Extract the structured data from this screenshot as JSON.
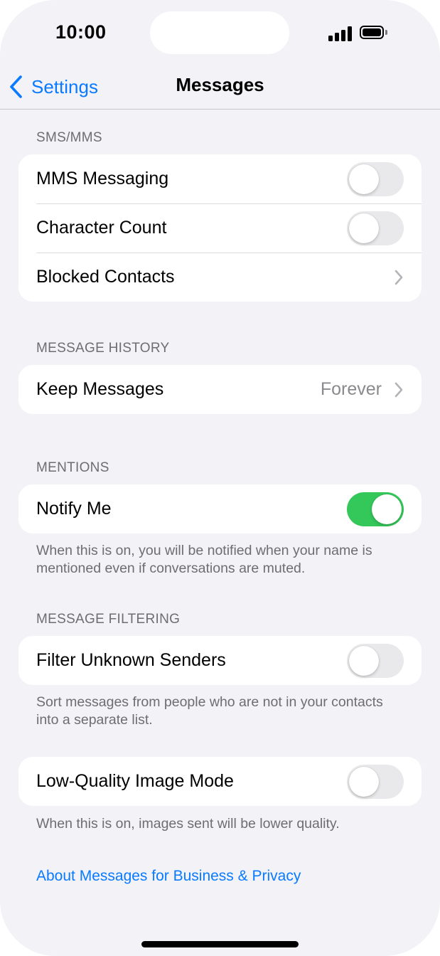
{
  "status_bar": {
    "time": "10:00"
  },
  "nav": {
    "back_label": "Settings",
    "title": "Messages"
  },
  "sections": {
    "sms_mms": {
      "header": "SMS/MMS",
      "mms_messaging": {
        "label": "MMS Messaging",
        "on": false
      },
      "character_count": {
        "label": "Character Count",
        "on": false
      },
      "blocked_contacts": {
        "label": "Blocked Contacts"
      }
    },
    "message_history": {
      "header": "MESSAGE HISTORY",
      "keep_messages": {
        "label": "Keep Messages",
        "value": "Forever"
      }
    },
    "mentions": {
      "header": "MENTIONS",
      "notify_me": {
        "label": "Notify Me",
        "on": true
      },
      "footer": "When this is on, you will be notified when your name is mentioned even if conversations are muted."
    },
    "message_filtering": {
      "header": "MESSAGE FILTERING",
      "filter_unknown": {
        "label": "Filter Unknown Senders",
        "on": false
      },
      "footer": "Sort messages from people who are not in your contacts into a separate list."
    },
    "low_quality": {
      "low_quality_mode": {
        "label": "Low-Quality Image Mode",
        "on": false
      },
      "footer": "When this is on, images sent will be lower quality."
    }
  },
  "about_link": "About Messages for Business & Privacy",
  "colors": {
    "accent": "#0a7aff",
    "toggle_on": "#34c759",
    "background": "#f2f2f7"
  }
}
